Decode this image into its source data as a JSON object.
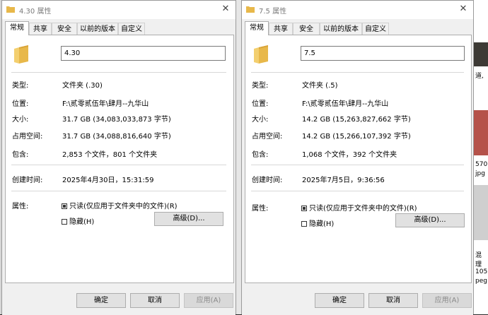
{
  "dialogs": [
    {
      "title": "4.30 属性",
      "tabs": [
        "常规",
        "共享",
        "安全",
        "以前的版本",
        "自定义"
      ],
      "name_value": "4.30",
      "rows": [
        {
          "label": "类型:",
          "value": "文件夹 (.30)"
        },
        {
          "label": "位置:",
          "value": "F:\\贰零贰伍年\\肆月--九华山"
        },
        {
          "label": "大小:",
          "value": "31.7 GB (34,083,033,873 字节)"
        },
        {
          "label": "占用空间:",
          "value": "31.7 GB (34,088,816,640 字节)"
        },
        {
          "label": "包含:",
          "value": "2,853 个文件，801 个文件夹"
        },
        {
          "label": "创建时间:",
          "value": "2025年4月30日，15:31:59"
        }
      ],
      "attributes_label": "属性:",
      "readonly_label": "只读(仅应用于文件夹中的文件)(R)",
      "hidden_label": "隐藏(H)",
      "advanced_button": "高级(D)...",
      "ok_button": "确定",
      "cancel_button": "取消",
      "apply_button": "应用(A)"
    },
    {
      "title": "7.5 属性",
      "tabs": [
        "常规",
        "共享",
        "安全",
        "以前的版本",
        "自定义"
      ],
      "name_value": "7.5",
      "rows": [
        {
          "label": "类型:",
          "value": "文件夹 (.5)"
        },
        {
          "label": "位置:",
          "value": "F:\\贰零贰伍年\\肆月--九华山"
        },
        {
          "label": "大小:",
          "value": "14.2 GB (15,263,827,662 字节)"
        },
        {
          "label": "占用空间:",
          "value": "14.2 GB (15,266,107,392 字节)"
        },
        {
          "label": "包含:",
          "value": "1,068 个文件，392 个文件夹"
        },
        {
          "label": "创建时间:",
          "value": "2025年7月5日，9:36:56"
        }
      ],
      "attributes_label": "属性:",
      "readonly_label": "只读(仅应用于文件夹中的文件)(R)",
      "hidden_label": "隐藏(H)",
      "advanced_button": "高级(D)...",
      "ok_button": "确定",
      "cancel_button": "取消",
      "apply_button": "应用(A)"
    }
  ],
  "background": {
    "texts": [
      "道,",
      "570",
      "jpg",
      "混",
      "理",
      "105",
      "peg"
    ]
  },
  "colors": {
    "folder": "#e8b84a",
    "panel": "#ffffff",
    "chrome": "#f0f0f0"
  }
}
